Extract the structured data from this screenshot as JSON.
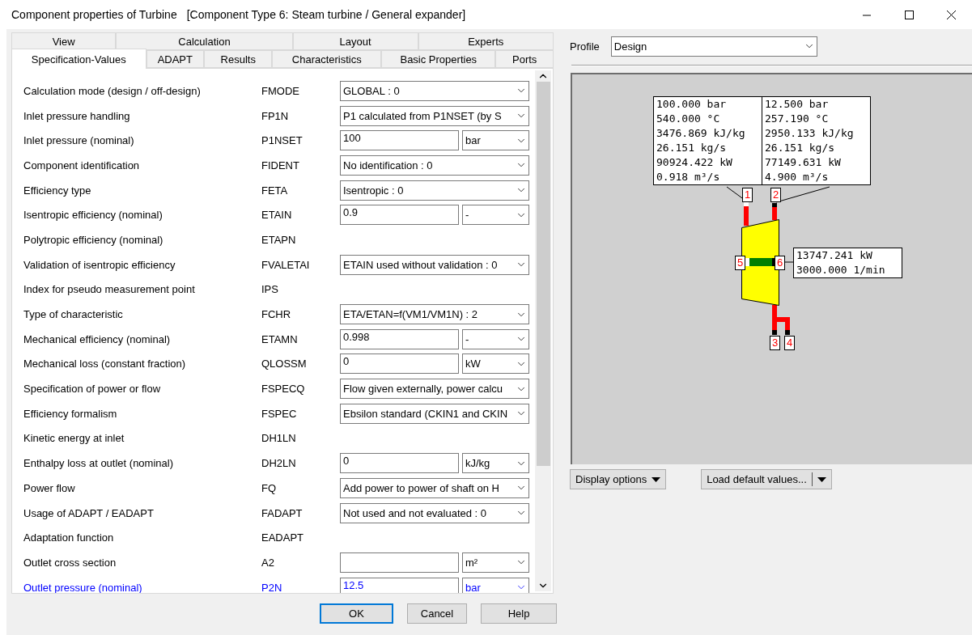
{
  "window": {
    "title": "Component properties of Turbine",
    "subtitle": "[Component Type 6: Steam turbine / General expander]"
  },
  "tabs": [
    [
      {
        "label": "View",
        "selected": false
      },
      {
        "label": "Calculation",
        "selected": false
      },
      {
        "label": "Layout",
        "selected": false
      },
      {
        "label": "Experts",
        "selected": false
      }
    ],
    [
      {
        "label": "Specification-Values",
        "selected": true
      },
      {
        "label": "ADAPT",
        "selected": false
      },
      {
        "label": "Results",
        "selected": false
      },
      {
        "label": "Characteristics",
        "selected": false
      },
      {
        "label": "Basic Properties",
        "selected": false
      },
      {
        "label": "Ports",
        "selected": false
      }
    ]
  ],
  "parameters": [
    {
      "label": "Calculation mode (design / off-design)",
      "code": "FMODE",
      "kind": "select",
      "value": "GLOBAL : 0",
      "highlighted": false
    },
    {
      "label": "Inlet pressure handling",
      "code": "FP1N",
      "kind": "select",
      "value": "P1 calculated from P1NSET (by S",
      "highlighted": false
    },
    {
      "label": "Inlet pressure (nominal)",
      "code": "P1NSET",
      "kind": "input",
      "value": "100",
      "unit": "bar",
      "highlighted": false
    },
    {
      "label": "Component identification",
      "code": "FIDENT",
      "kind": "select",
      "value": "No identification : 0",
      "highlighted": false
    },
    {
      "label": "Efficiency type",
      "code": "FETA",
      "kind": "select",
      "value": "Isentropic : 0",
      "highlighted": false
    },
    {
      "label": "Isentropic efficiency (nominal)",
      "code": "ETAIN",
      "kind": "input",
      "value": "0.9",
      "unit": "-",
      "highlighted": false
    },
    {
      "label": "Polytropic efficiency (nominal)",
      "code": "ETAPN",
      "kind": "none",
      "highlighted": false
    },
    {
      "label": "Validation of isentropic efficiency",
      "code": "FVALETAI",
      "kind": "select",
      "value": "ETAIN used without validation : 0",
      "highlighted": false
    },
    {
      "label": "Index for pseudo measurement point",
      "code": "IPS",
      "kind": "none",
      "highlighted": false
    },
    {
      "label": "Type of characteristic",
      "code": "FCHR",
      "kind": "select",
      "value": "ETA/ETAN=f(VM1/VM1N) : 2",
      "highlighted": false
    },
    {
      "label": "Mechanical efficiency (nominal)",
      "code": "ETAMN",
      "kind": "input",
      "value": "0.998",
      "unit": "-",
      "highlighted": false
    },
    {
      "label": "Mechanical loss (constant fraction)",
      "code": "QLOSSM",
      "kind": "input",
      "value": "0",
      "unit": "kW",
      "highlighted": false
    },
    {
      "label": "Specification of power or flow",
      "code": "FSPECQ",
      "kind": "select",
      "value": "Flow given externally, power calcu",
      "highlighted": false
    },
    {
      "label": "Efficiency formalism",
      "code": "FSPEC",
      "kind": "select",
      "value": "Ebsilon standard (CKIN1 and CKIN",
      "highlighted": false
    },
    {
      "label": "Kinetic energy at inlet",
      "code": "DH1LN",
      "kind": "none",
      "highlighted": false
    },
    {
      "label": "Enthalpy loss at outlet (nominal)",
      "code": "DH2LN",
      "kind": "input",
      "value": "0",
      "unit": "kJ/kg",
      "highlighted": false
    },
    {
      "label": "Power flow",
      "code": "FQ",
      "kind": "select",
      "value": "Add power to power of shaft on H",
      "highlighted": false
    },
    {
      "label": "Usage of ADAPT / EADAPT",
      "code": "FADAPT",
      "kind": "select",
      "value": "Not used and not evaluated : 0",
      "highlighted": false
    },
    {
      "label": "Adaptation function",
      "code": "EADAPT",
      "kind": "none",
      "highlighted": false
    },
    {
      "label": "Outlet cross section",
      "code": "A2",
      "kind": "input",
      "unit": "m²",
      "highlighted": false
    },
    {
      "label": "Outlet pressure (nominal)",
      "code": "P2N",
      "kind": "input",
      "value": "12.5",
      "unit": "bar",
      "highlighted": true
    }
  ],
  "buttons": [
    {
      "label": "OK",
      "focused": true
    },
    {
      "label": "Cancel",
      "focused": false
    },
    {
      "label": "Help",
      "focused": false
    }
  ],
  "profile": {
    "label": "Profile",
    "value": "Design"
  },
  "diagram": {
    "inlet_values": [
      "100.000 bar",
      "540.000 °C",
      "3476.869 kJ/kg",
      "26.151 kg/s",
      "90924.422 kW",
      "0.918 m³/s"
    ],
    "outlet_values": [
      "12.500 bar",
      "257.190 °C",
      "2950.133 kJ/kg",
      "26.151 kg/s",
      "77149.631 kW",
      "4.900 m³/s"
    ],
    "shaft_values": [
      "13747.241 kW",
      "3000.000 1/min"
    ],
    "ports": [
      "1",
      "2",
      "3",
      "4",
      "5",
      "6"
    ]
  },
  "diagram_buttons": [
    "Display options",
    "Load default values..."
  ]
}
